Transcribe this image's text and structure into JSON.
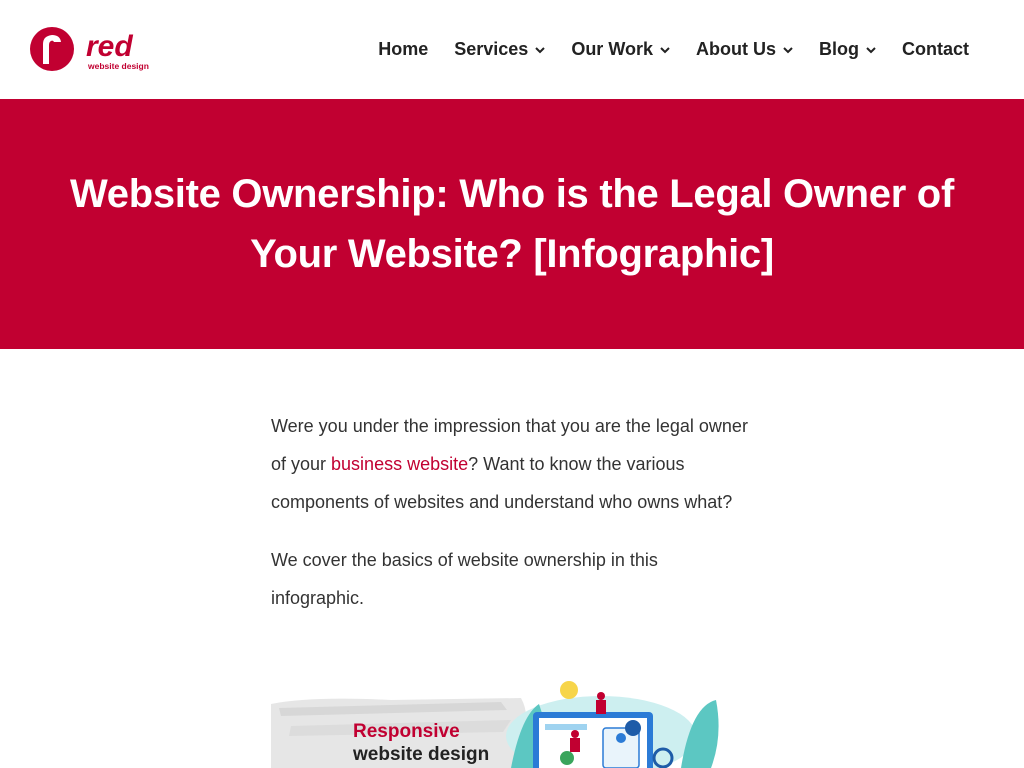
{
  "brand": {
    "name": "red",
    "tagline": "website design",
    "color": "#c10031"
  },
  "nav": {
    "items": [
      {
        "label": "Home",
        "has_dropdown": false
      },
      {
        "label": "Services",
        "has_dropdown": true
      },
      {
        "label": "Our Work",
        "has_dropdown": true
      },
      {
        "label": "About Us",
        "has_dropdown": true
      },
      {
        "label": "Blog",
        "has_dropdown": true
      },
      {
        "label": "Contact",
        "has_dropdown": false
      }
    ]
  },
  "hero": {
    "title": "Website Ownership: Who is the Legal Owner of Your Website? [Infographic]"
  },
  "content": {
    "p1_before": "Were you under the impression that you are the legal owner of your ",
    "p1_link": "business website",
    "p1_after": "? Want to know the various components of websites and understand who owns what?",
    "p2": "We cover the basics of website ownership in this infographic."
  },
  "infographic": {
    "line1": "Responsive",
    "line2": "website design"
  }
}
